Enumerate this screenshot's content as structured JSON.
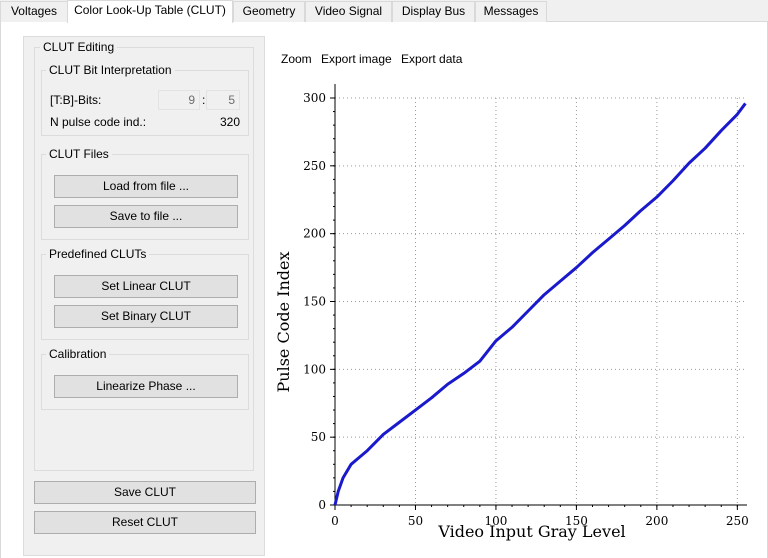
{
  "tabs": [
    {
      "label": "Voltages",
      "active": false
    },
    {
      "label": "Color Look-Up Table (CLUT)",
      "active": true
    },
    {
      "label": "Geometry",
      "active": false
    },
    {
      "label": "Video Signal",
      "active": false
    },
    {
      "label": "Display Bus",
      "active": false
    },
    {
      "label": "Messages",
      "active": false
    }
  ],
  "clut_editing": {
    "title": "CLUT Editing",
    "bit_interp": {
      "title": "CLUT Bit Interpretation",
      "tb_bits_label": "[T:B]-Bits:",
      "t_value": "9",
      "separator": ":",
      "b_value": "5",
      "n_pulse_label": "N pulse code ind.:",
      "n_pulse_value": "320"
    },
    "files": {
      "title": "CLUT Files",
      "load_label": "Load from file ...",
      "save_label": "Save to file ..."
    },
    "predefined": {
      "title": "Predefined CLUTs",
      "linear_label": "Set Linear CLUT",
      "binary_label": "Set Binary CLUT"
    },
    "calibration": {
      "title": "Calibration",
      "linearize_label": "Linearize Phase ..."
    }
  },
  "bottom_buttons": {
    "save_label": "Save CLUT",
    "reset_label": "Reset CLUT"
  },
  "plot_toolbar": {
    "zoom_label": "Zoom",
    "export_image_label": "Export image",
    "export_data_label": "Export data"
  },
  "colors": {
    "series": "#1a1acc",
    "grid": "#9a9a9a"
  },
  "chart_data": {
    "type": "line",
    "title": "",
    "xlabel": "Video Input Gray Level",
    "ylabel": "Pulse Code Index",
    "xlim": [
      0,
      256
    ],
    "ylim": [
      0,
      300
    ],
    "xticks": [
      0,
      50,
      100,
      150,
      200,
      250
    ],
    "yticks": [
      0,
      50,
      100,
      150,
      200,
      250,
      300
    ],
    "grid": true,
    "series": [
      {
        "x": [
          0,
          2,
          5,
          10,
          15,
          20,
          25,
          30,
          40,
          50,
          60,
          70,
          80,
          90,
          100,
          110,
          120,
          130,
          140,
          150,
          160,
          170,
          180,
          190,
          200,
          210,
          220,
          230,
          240,
          250,
          255
        ],
        "y": [
          0,
          10,
          20,
          30,
          35,
          40,
          46,
          52,
          61,
          70,
          79,
          89,
          97,
          106,
          121,
          131,
          143,
          155,
          165,
          175,
          186,
          196,
          206,
          217,
          227,
          239,
          252,
          263,
          276,
          288,
          296
        ]
      }
    ]
  }
}
